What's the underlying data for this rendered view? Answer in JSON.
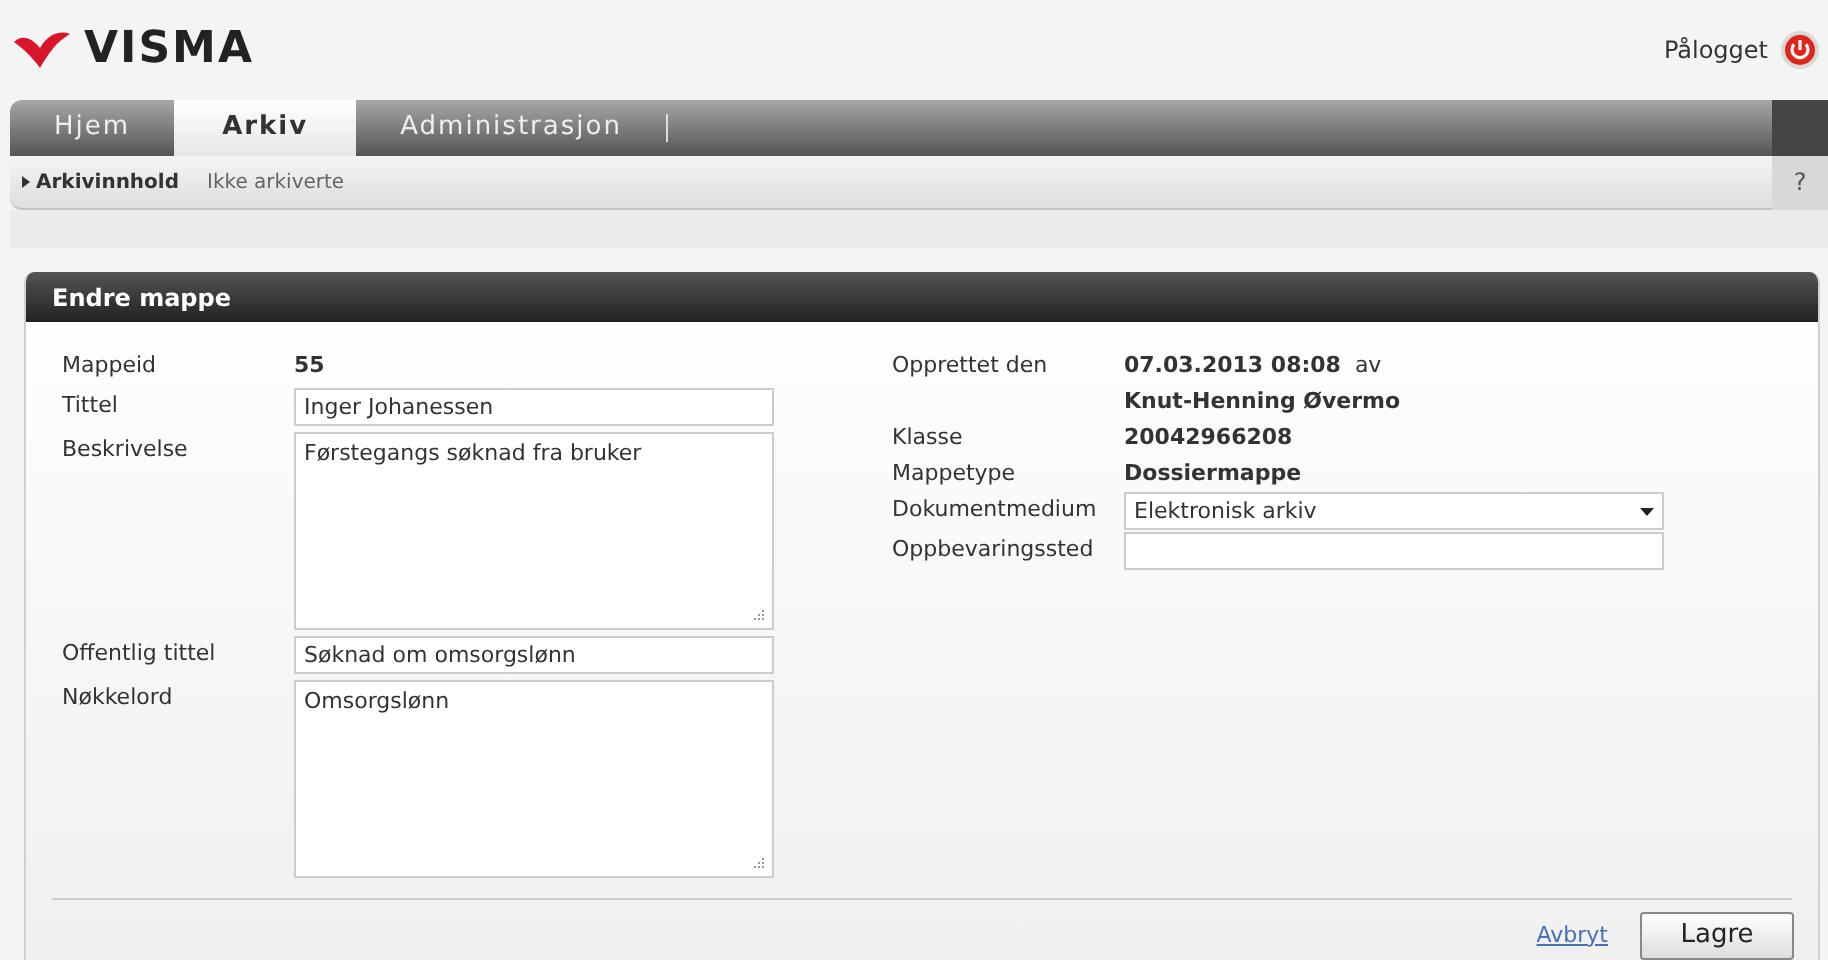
{
  "header": {
    "logo": "VISMA",
    "login_label": "Pålogget"
  },
  "tabs": [
    {
      "label": "Hjem",
      "selected": false
    },
    {
      "label": "Arkiv",
      "selected": true
    },
    {
      "label": "Administrasjon",
      "selected": false
    }
  ],
  "subnav": {
    "items": [
      {
        "label": "Arkivinnhold",
        "selected": true
      },
      {
        "label": "Ikke arkiverte",
        "selected": false
      }
    ],
    "help": "?"
  },
  "panel": {
    "title": "Endre mappe",
    "left_fields": [
      {
        "kind": "static",
        "label": "Mappeid",
        "value": "55"
      },
      {
        "kind": "input",
        "label": "Tittel",
        "value": "Inger Johanessen"
      },
      {
        "kind": "textarea",
        "label": "Beskrivelse",
        "value": "Førstegangs søknad fra bruker"
      },
      {
        "kind": "input",
        "label": "Offentlig tittel",
        "value": "Søknad om omsorgslønn"
      },
      {
        "kind": "textarea",
        "label": "Nøkkelord",
        "value": "Omsorgslønn"
      }
    ],
    "right_fields": [
      {
        "kind": "created",
        "label": "Opprettet den",
        "value": "07.03.2013 08:08",
        "by_label": "av",
        "by": "Knut-Henning Øvermo"
      },
      {
        "kind": "static",
        "label": "Klasse",
        "value": "20042966208"
      },
      {
        "kind": "static",
        "label": "Mappetype",
        "value": "Dossiermappe"
      },
      {
        "kind": "select",
        "label": "Dokumentmedium",
        "value": "Elektronisk arkiv"
      },
      {
        "kind": "input",
        "label": "Oppbevaringssted"
      }
    ],
    "actions": {
      "cancel": "Avbryt",
      "save": "Lagre"
    }
  }
}
